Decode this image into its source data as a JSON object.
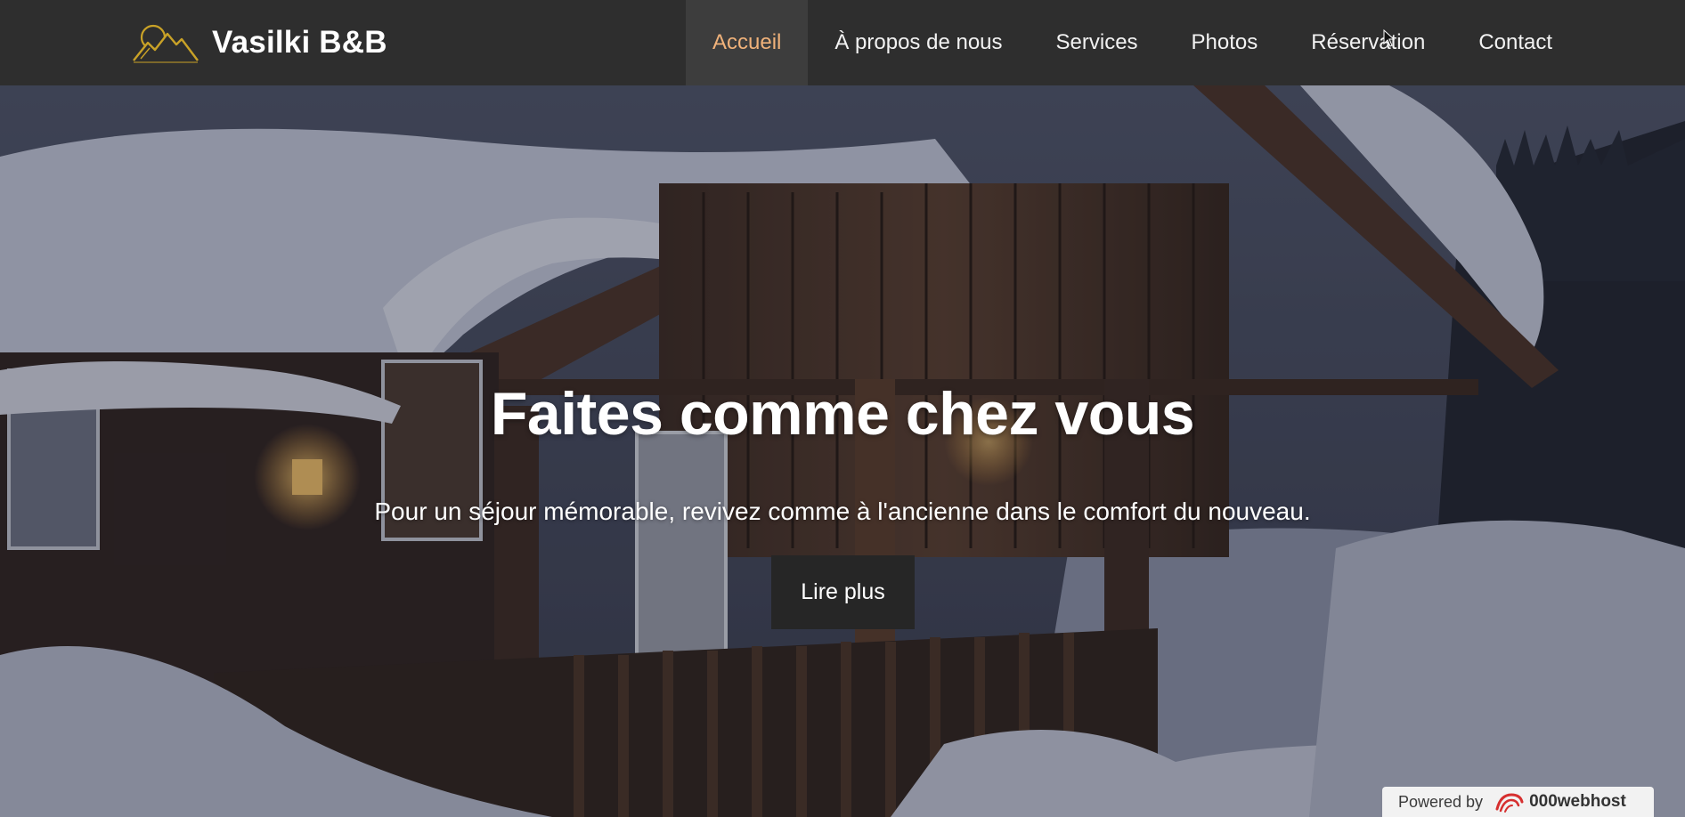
{
  "brand": {
    "name": "Vasilki B&B",
    "logo_icon": "sun-mountains-logo-icon",
    "logo_color": "#c9a227"
  },
  "nav": {
    "items": [
      {
        "label": "Accueil",
        "active": true
      },
      {
        "label": "À propos de nous",
        "active": false
      },
      {
        "label": "Services",
        "active": false
      },
      {
        "label": "Photos",
        "active": false
      },
      {
        "label": "Réservation",
        "active": false
      },
      {
        "label": "Contact",
        "active": false
      }
    ],
    "active_color": "#f0b27a"
  },
  "hero": {
    "title": "Faites comme chez vous",
    "subtitle": "Pour un séjour mémorable, revivez comme à l'ancienne dans le comfort du nouveau.",
    "button_label": "Lire plus",
    "background_icon": "snowy-cabin-photo"
  },
  "host_badge": {
    "prefix": "Powered by",
    "name": "000webhost",
    "icon": "000webhost-swirl-icon"
  }
}
